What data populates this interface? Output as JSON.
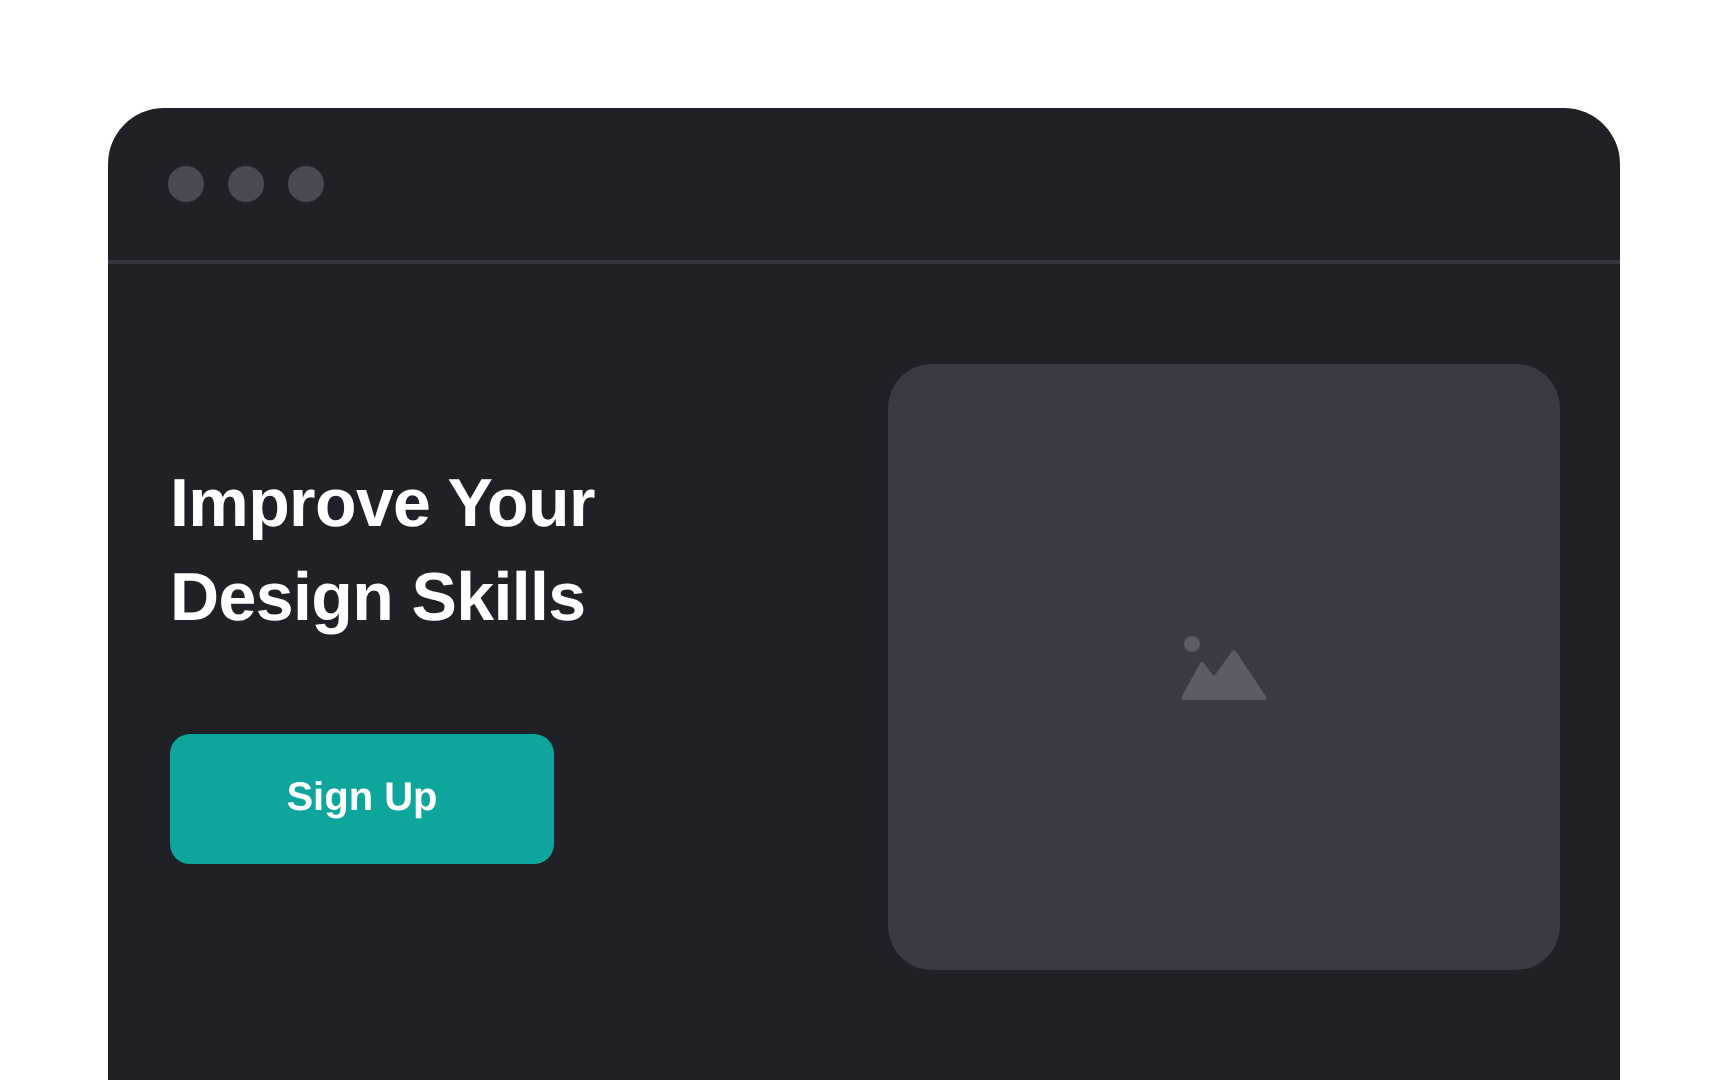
{
  "hero": {
    "title": "Improve Your Design Skills",
    "button": "Sign Up"
  }
}
